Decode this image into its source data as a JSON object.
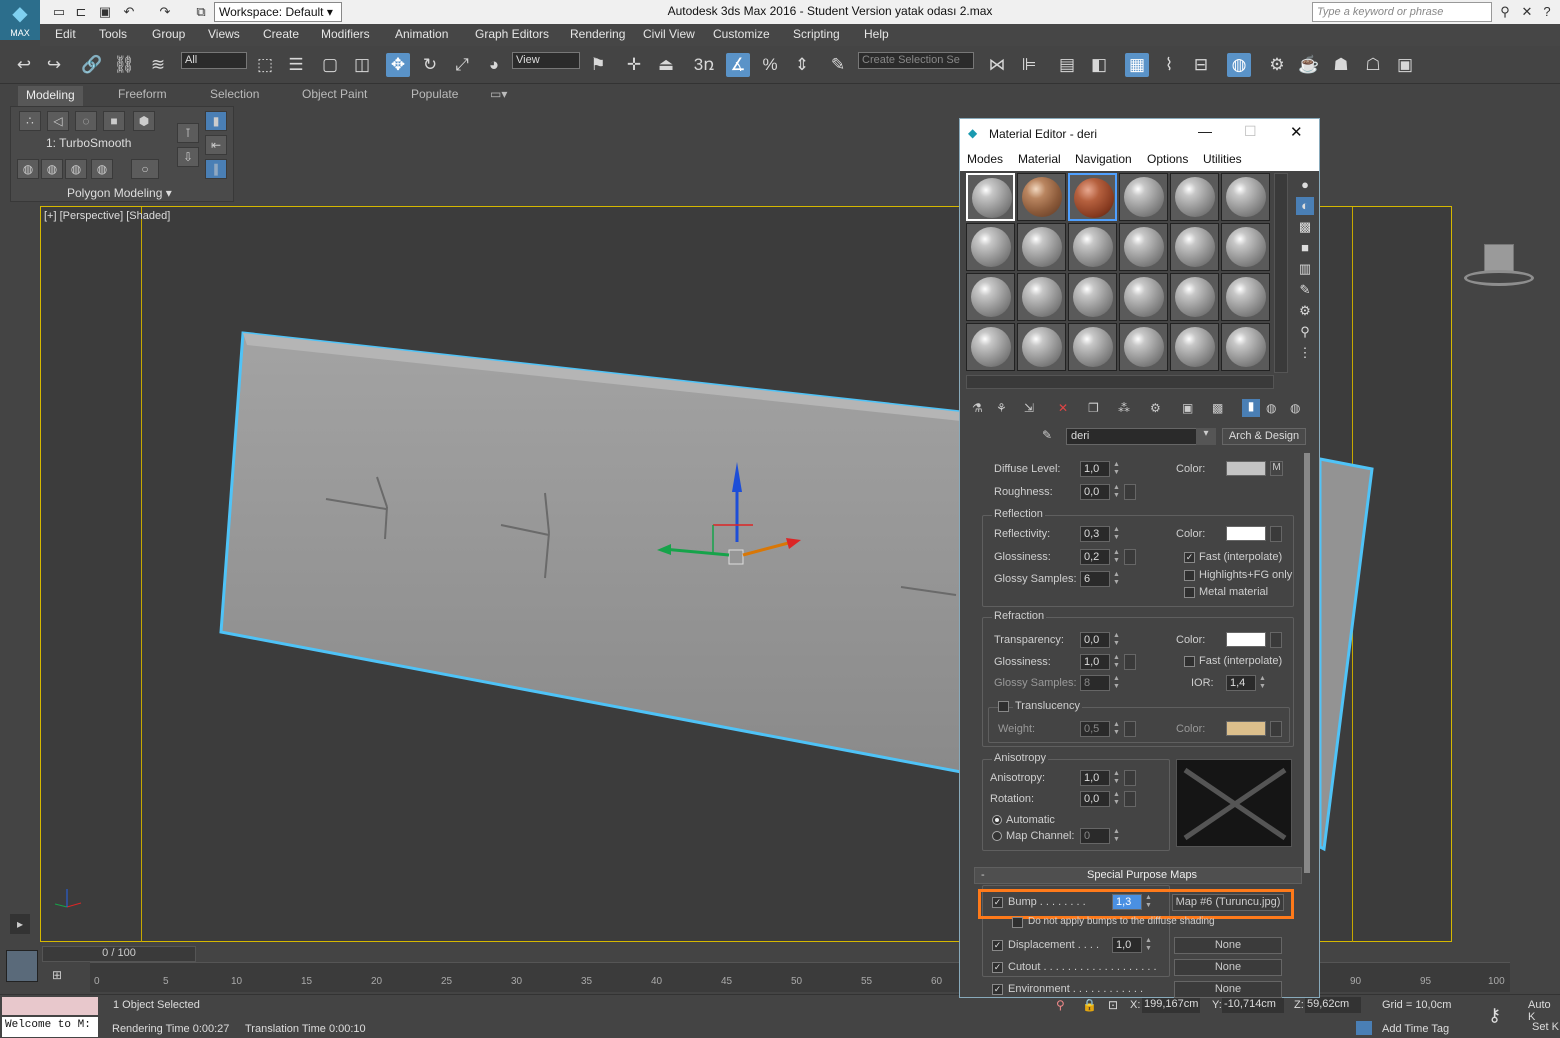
{
  "titlebar": {
    "logo": "MAX",
    "workspace": "Workspace: Default",
    "title": "Autodesk 3ds Max 2016 - Student Version    yatak odası 2.max",
    "search_placeholder": "Type a keyword or phrase"
  },
  "menus": [
    "Edit",
    "Tools",
    "Group",
    "Views",
    "Create",
    "Modifiers",
    "Animation",
    "Graph Editors",
    "Rendering",
    "Civil View",
    "Customize",
    "Scripting",
    "Help"
  ],
  "toolbar": {
    "filter": "All",
    "refcoord": "View",
    "selection_set": "Create Selection Se",
    "snap_3": "3"
  },
  "ribbon": {
    "tabs": [
      "Modeling",
      "Freeform",
      "Selection",
      "Object Paint",
      "Populate"
    ],
    "modifier": "1: TurboSmooth",
    "panel": "Polygon Modeling ▾"
  },
  "viewport": {
    "label": "[+] [Perspective] [Shaded]"
  },
  "timeline": {
    "frame": "0 / 100",
    "ticks": [
      "0",
      "5",
      "10",
      "15",
      "20",
      "25",
      "30",
      "35",
      "40",
      "45",
      "50",
      "55",
      "60",
      "90",
      "95",
      "100"
    ]
  },
  "status": {
    "selected": "1 Object Selected",
    "render_time": "Rendering Time  0:00:27",
    "translation_time": "Translation Time  0:00:10",
    "maxscript": "Welcome to M:",
    "x": "199,167cm",
    "y": "-10,714cm",
    "z": "59,62cm",
    "grid": "Grid = 10,0cm",
    "auto": "Auto K",
    "set": "Set K",
    "add_tag": "Add Time Tag"
  },
  "mat": {
    "title": "Material Editor - deri",
    "menu": [
      "Modes",
      "Material",
      "Navigation",
      "Options",
      "Utilities"
    ],
    "name": "deri",
    "type": "Arch & Design",
    "diffuse_level_label": "Diffuse Level:",
    "diffuse_level": "1,0",
    "roughness_label": "Roughness:",
    "roughness": "0,0",
    "color_label": "Color:",
    "m": "M",
    "reflection": "Reflection",
    "reflectivity_label": "Reflectivity:",
    "reflectivity": "0,3",
    "glossiness_label": "Glossiness:",
    "r_gloss": "0,2",
    "glossy_samples_label": "Glossy Samples:",
    "r_samples": "6",
    "fast_interp": "Fast (interpolate)",
    "highlights": "Highlights+FG only",
    "metal": "Metal material",
    "refraction": "Refraction",
    "transparency_label": "Transparency:",
    "transparency": "0,0",
    "t_gloss": "1,0",
    "t_samples": "8",
    "ior_label": "IOR:",
    "ior": "1,4",
    "translucency": "Translucency",
    "weight_label": "Weight:",
    "weight": "0,5",
    "anisotropy_group": "Anisotropy",
    "anisotropy_label": "Anisotropy:",
    "anisotropy": "1,0",
    "rotation_label": "Rotation:",
    "rotation": "0,0",
    "automatic": "Automatic",
    "map_channel_label": "Map Channel:",
    "map_channel": "0",
    "special_maps": "Special Purpose Maps",
    "collapse": "-",
    "bump_label": "Bump . . . . . . . .",
    "bump": "1,3",
    "bump_map": "Map #6 (Turuncu.jpg)",
    "no_bump_diffuse": "Do not apply bumps to the diffuse shading",
    "displacement_label": "Displacement . . . .",
    "displacement": "1,0",
    "none": "None",
    "cutout_label": "Cutout . . . . . . . . . . . . . . . . . . .",
    "environment_label": "Environment . . . . . . . . . . . ."
  },
  "colors": {
    "accent": "#5a93c8",
    "highlight": "#ff7a1a",
    "selection": "#4fc3f7",
    "viewport_border": "#d5b800",
    "refl_color": "#ffffff",
    "diffuse_color": "#c4c4c4",
    "weight_color": "#dcbf8c"
  }
}
